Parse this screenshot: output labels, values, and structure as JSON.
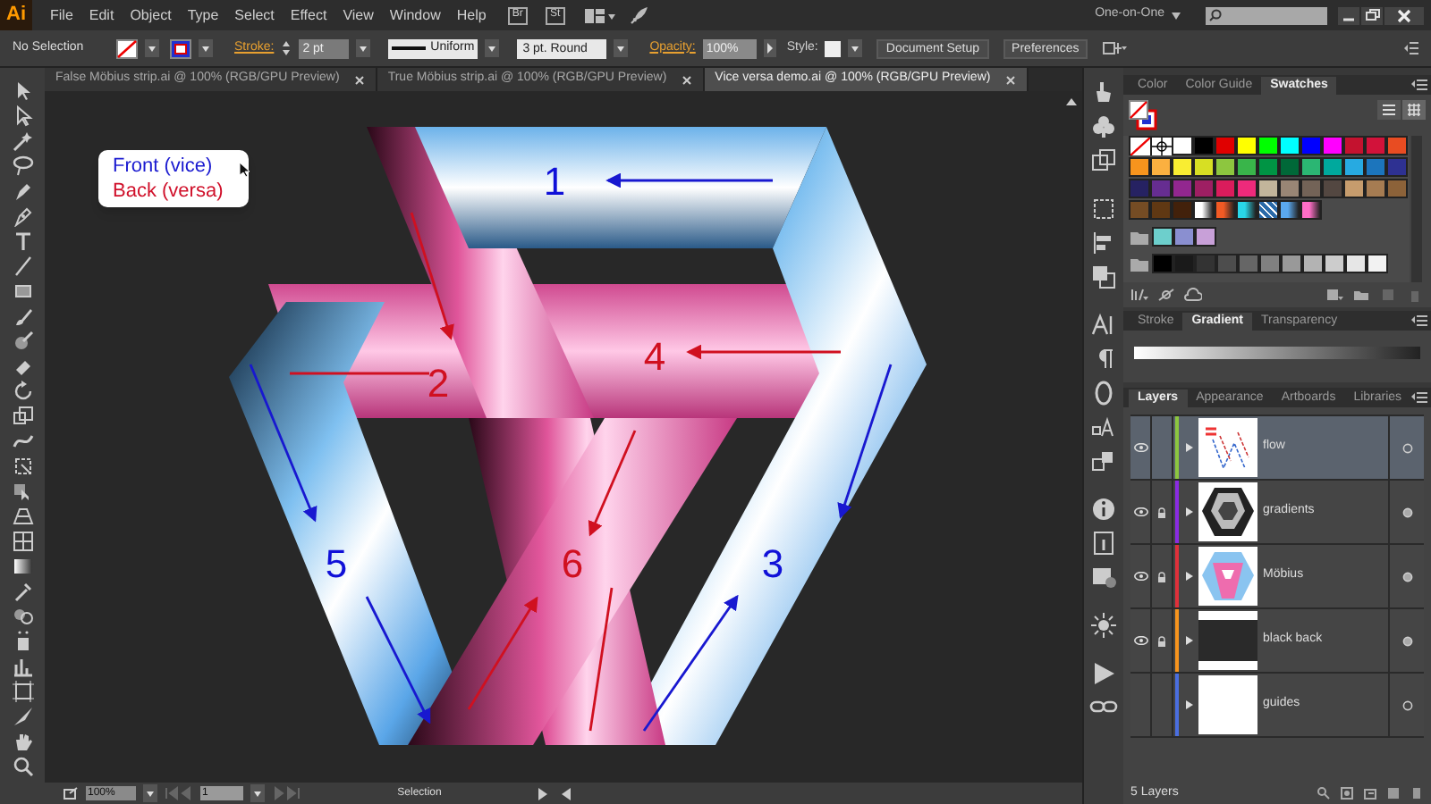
{
  "app": {
    "logo": "Ai",
    "bridge": "Br",
    "stock": "St"
  },
  "menu": [
    "File",
    "Edit",
    "Object",
    "Type",
    "Select",
    "Effect",
    "View",
    "Window",
    "Help"
  ],
  "workspace": "One-on-One",
  "control_bar": {
    "selection": "No Selection",
    "stroke_label": "Stroke:",
    "stroke_weight": "2 pt",
    "profile": "Uniform",
    "brush": "3 pt. Round",
    "opacity_label": "Opacity:",
    "opacity": "100%",
    "style_label": "Style:",
    "buttons": [
      "Document Setup",
      "Preferences"
    ]
  },
  "tabs": [
    {
      "label": "False Möbius strip.ai @ 100% (RGB/GPU Preview)",
      "selected": false
    },
    {
      "label": "True Möbius strip.ai @ 100% (RGB/GPU Preview)",
      "selected": false
    },
    {
      "label": "Vice versa demo.ai @ 100% (RGB/GPU Preview)",
      "selected": true
    }
  ],
  "legend": [
    {
      "text": "Front (vice)",
      "color": "#1a1ad0"
    },
    {
      "text": "Back (versa)",
      "color": "#d0102a"
    }
  ],
  "steps": [
    {
      "label": "1",
      "color": "#1010d8"
    },
    {
      "label": "2",
      "color": "#d01020"
    },
    {
      "label": "3",
      "color": "#1010d8"
    },
    {
      "label": "4",
      "color": "#d01020"
    },
    {
      "label": "5",
      "color": "#1010d8"
    },
    {
      "label": "6",
      "color": "#d01020"
    }
  ],
  "swatches_panel": {
    "tabs": [
      {
        "label": "Color",
        "selected": false
      },
      {
        "label": "Color Guide",
        "selected": false
      },
      {
        "label": "Swatches",
        "selected": true
      }
    ],
    "rows": [
      {
        "folder": false,
        "swatches": [
          {
            "kind": "none"
          },
          {
            "kind": "registration"
          },
          {
            "kind": "solid",
            "color": "#ffffff"
          },
          {
            "kind": "solid",
            "color": "#000000"
          },
          {
            "kind": "solid",
            "color": "#e00000"
          },
          {
            "kind": "solid",
            "color": "#ffff00"
          },
          {
            "kind": "solid",
            "color": "#00ff00"
          },
          {
            "kind": "solid",
            "color": "#00ffff"
          },
          {
            "kind": "solid",
            "color": "#0000ff"
          },
          {
            "kind": "solid",
            "color": "#ff00ff"
          },
          {
            "kind": "solid",
            "color": "#c4122f"
          },
          {
            "kind": "solid",
            "color": "#d2123a"
          },
          {
            "kind": "solid",
            "color": "#e84c22"
          }
        ]
      },
      {
        "folder": false,
        "swatches": [
          {
            "kind": "solid",
            "color": "#f7941d"
          },
          {
            "kind": "solid",
            "color": "#fbb040"
          },
          {
            "kind": "solid",
            "color": "#f9ed32"
          },
          {
            "kind": "solid",
            "color": "#d7df23"
          },
          {
            "kind": "solid",
            "color": "#8dc63f"
          },
          {
            "kind": "solid",
            "color": "#39b54a"
          },
          {
            "kind": "solid",
            "color": "#009444"
          },
          {
            "kind": "solid",
            "color": "#006838"
          },
          {
            "kind": "solid",
            "color": "#2bb673"
          },
          {
            "kind": "solid",
            "color": "#00a99d"
          },
          {
            "kind": "solid",
            "color": "#27aae1"
          },
          {
            "kind": "solid",
            "color": "#1c75bc"
          },
          {
            "kind": "solid",
            "color": "#2e3192"
          }
        ]
      },
      {
        "folder": false,
        "swatches": [
          {
            "kind": "solid",
            "color": "#262262"
          },
          {
            "kind": "solid",
            "color": "#662d91"
          },
          {
            "kind": "solid",
            "color": "#92278f"
          },
          {
            "kind": "solid",
            "color": "#9e1f63"
          },
          {
            "kind": "solid",
            "color": "#da1c5c"
          },
          {
            "kind": "solid",
            "color": "#ee2a7b"
          },
          {
            "kind": "solid",
            "color": "#c2b59b"
          },
          {
            "kind": "solid",
            "color": "#998675"
          },
          {
            "kind": "solid",
            "color": "#736357"
          },
          {
            "kind": "solid",
            "color": "#534741"
          },
          {
            "kind": "solid",
            "color": "#c69c6d"
          },
          {
            "kind": "solid",
            "color": "#a67c52"
          },
          {
            "kind": "solid",
            "color": "#8c6239"
          }
        ]
      },
      {
        "folder": false,
        "swatches": [
          {
            "kind": "solid",
            "color": "#754c24"
          },
          {
            "kind": "solid",
            "color": "#603813"
          },
          {
            "kind": "solid",
            "color": "#42210b"
          },
          {
            "kind": "gradient",
            "color": "#ffffff"
          },
          {
            "kind": "gradient",
            "color": "#f15a24"
          },
          {
            "kind": "gradient",
            "color": "#29d6e8"
          },
          {
            "kind": "pattern",
            "color": "#2a6aa8"
          },
          {
            "kind": "gradient",
            "color": "#5aa8ee"
          },
          {
            "kind": "gradient",
            "color": "#ff6ec7"
          }
        ]
      },
      {
        "folder": true,
        "swatches": [
          {
            "kind": "solid",
            "color": "#6dcfcc"
          },
          {
            "kind": "solid",
            "color": "#8a8fd0"
          },
          {
            "kind": "solid",
            "color": "#c8a0d8"
          }
        ]
      },
      {
        "folder": true,
        "swatches": [
          {
            "kind": "solid",
            "color": "#000000"
          },
          {
            "kind": "solid",
            "color": "#1a1a1a"
          },
          {
            "kind": "solid",
            "color": "#333333"
          },
          {
            "kind": "solid",
            "color": "#4d4d4d"
          },
          {
            "kind": "solid",
            "color": "#666666"
          },
          {
            "kind": "solid",
            "color": "#808080"
          },
          {
            "kind": "solid",
            "color": "#999999"
          },
          {
            "kind": "solid",
            "color": "#b3b3b3"
          },
          {
            "kind": "solid",
            "color": "#cccccc"
          },
          {
            "kind": "solid",
            "color": "#e6e6e6"
          },
          {
            "kind": "solid",
            "color": "#f2f2f2"
          }
        ]
      }
    ]
  },
  "gradient_panel": {
    "tabs": [
      {
        "label": "Stroke",
        "selected": false
      },
      {
        "label": "Gradient",
        "selected": true
      },
      {
        "label": "Transparency",
        "selected": false
      }
    ]
  },
  "layers_panel": {
    "tabs": [
      {
        "label": "Layers",
        "selected": true
      },
      {
        "label": "Appearance",
        "selected": false
      },
      {
        "label": "Artboards",
        "selected": false
      },
      {
        "label": "Libraries",
        "selected": false
      }
    ],
    "layers": [
      {
        "name": "flow",
        "visible": true,
        "locked": false,
        "color": "#8cc63f",
        "selected": true,
        "kind": "flow"
      },
      {
        "name": "gradients",
        "visible": true,
        "locked": true,
        "color": "#8a2be2",
        "selected": false,
        "kind": "gradients"
      },
      {
        "name": "Möbius",
        "visible": true,
        "locked": true,
        "color": "#e0303a",
        "selected": false,
        "kind": "mobius"
      },
      {
        "name": "black back",
        "visible": true,
        "locked": true,
        "color": "#f7941d",
        "selected": false,
        "kind": "black"
      },
      {
        "name": "guides",
        "visible": false,
        "locked": false,
        "color": "#4a6ee0",
        "selected": false,
        "kind": "blank"
      }
    ],
    "count": "5 Layers"
  },
  "status": {
    "zoom": "100%",
    "artboard": "1",
    "tool": "Selection"
  }
}
